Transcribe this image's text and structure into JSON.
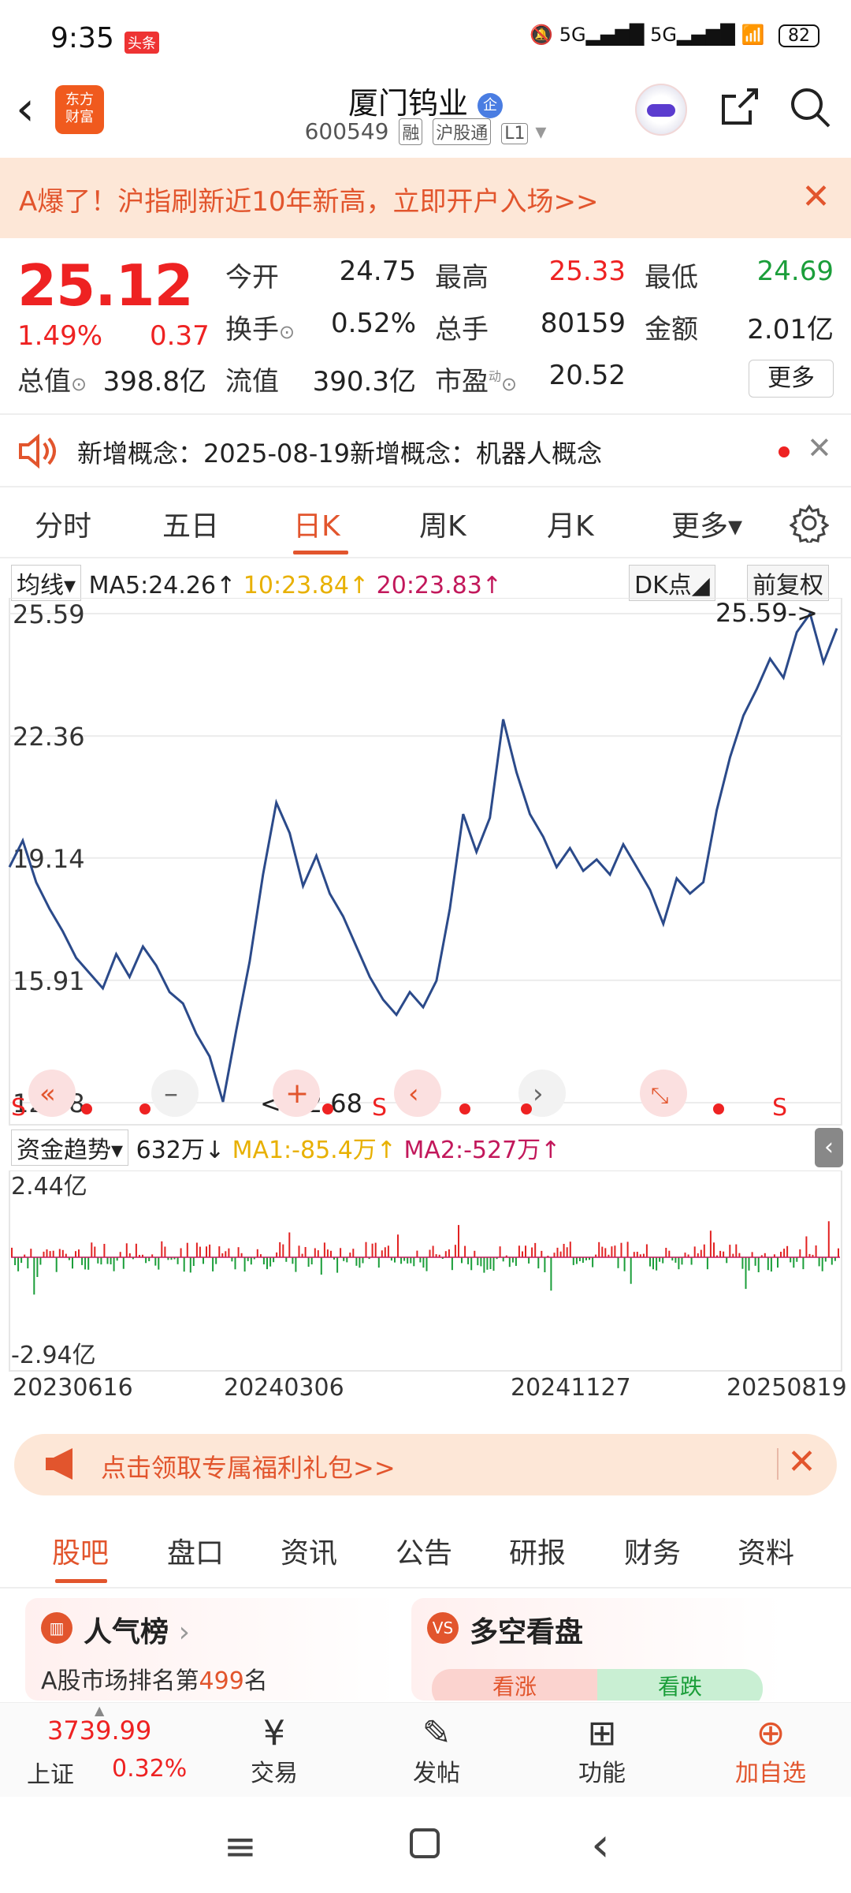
{
  "status": {
    "time": "9:35",
    "tag": "头条",
    "signal": "5G",
    "battery": "82"
  },
  "header": {
    "back": "‹",
    "logo": "东方\n财富",
    "name": "厦门钨业",
    "name_badge": "企",
    "code": "600549",
    "badges": [
      "融",
      "沪股通",
      "L1"
    ]
  },
  "banner": {
    "text": "A爆了！沪指刷新近10年新高，立即开户入场>>",
    "close": "✕"
  },
  "quote": {
    "price": "25.12",
    "pct": "1.49%",
    "change": "0.37",
    "rows": [
      [
        {
          "l": "今开",
          "v": "24.75",
          "c": ""
        },
        {
          "l": "最高",
          "v": "25.33",
          "c": "red"
        },
        {
          "l": "最低",
          "v": "24.69",
          "c": "green"
        }
      ],
      [
        {
          "l": "换手",
          "v": "0.52%",
          "c": ""
        },
        {
          "l": "总手",
          "v": "80159",
          "c": ""
        },
        {
          "l": "金额",
          "v": "2.01亿",
          "c": ""
        }
      ]
    ],
    "total_value_label": "总值",
    "total_value": "398.8亿",
    "float_label": "流值",
    "float_value": "390.3亿",
    "pe_label": "市盈",
    "pe_sup": "动",
    "pe_value": "20.52",
    "more": "更多"
  },
  "notice": {
    "text": "新增概念：2025-08-19新增概念：机器人概念",
    "close": "✕"
  },
  "tabs": [
    "分时",
    "五日",
    "日K",
    "周K",
    "月K",
    "更多▾"
  ],
  "active_tab": 2,
  "chart": {
    "ma_select": "均线▾",
    "ma5": "MA5:24.26↑",
    "ma10": "10:23.84↑",
    "ma20": "20:23.83↑",
    "dk": "DK点",
    "adjust": "前复权",
    "colors": {
      "ma5": "#222222",
      "ma10": "#e8b000",
      "ma20": "#c2185b",
      "price": "#2b4a8a",
      "up": "#e22222",
      "down": "#1b9e3a"
    }
  },
  "chart_data": {
    "type": "line",
    "title": "",
    "yticks": [
      "25.59",
      "22.36",
      "19.14",
      "15.91",
      "12.68"
    ],
    "ylim": [
      12.68,
      25.59
    ],
    "max_label": "25.59->",
    "min_label": "<-12.68",
    "x": [
      "20230616",
      "20240306",
      "20241127",
      "20250819"
    ],
    "series": [
      {
        "values": [
          18.9,
          19.6,
          18.5,
          17.8,
          17.2,
          16.5,
          16.1,
          15.7,
          16.6,
          16.0,
          16.8,
          16.3,
          15.6,
          15.3,
          14.5,
          13.9,
          12.7,
          14.6,
          16.4,
          18.7,
          20.6,
          19.8,
          18.4,
          19.2,
          18.2,
          17.6,
          16.8,
          16.0,
          15.4,
          15.0,
          15.6,
          15.2,
          15.9,
          17.8,
          20.3,
          19.3,
          20.2,
          22.8,
          21.4,
          20.3,
          19.7,
          18.9,
          19.4,
          18.8,
          19.1,
          18.7,
          19.5,
          18.9,
          18.3,
          17.4,
          18.6,
          18.2,
          18.5,
          20.4,
          21.8,
          22.9,
          23.6,
          24.4,
          23.9,
          25.1,
          25.59,
          24.3,
          25.2
        ]
      }
    ],
    "fund": {
      "label": "资金趋势▾",
      "value": "632万↓",
      "ma1": "MA1:-85.4万↑",
      "ma2": "MA2:-527万↑",
      "ymax": "2.44亿",
      "ymin": "-2.94亿"
    }
  },
  "gift": {
    "text": "点击领取专属福利礼包>>",
    "close": "✕"
  },
  "sub_tabs": [
    "股吧",
    "盘口",
    "资讯",
    "公告",
    "研报",
    "财务",
    "资料"
  ],
  "cards": [
    {
      "title": "人气榜",
      "arrow": "›",
      "sub_prefix": "A股市场排名第",
      "rank": "499",
      "sub_suffix": "名"
    },
    {
      "title": "多空看盘",
      "bull": "看涨",
      "bear": "看跌"
    }
  ],
  "bottom_nav": {
    "index_value": "3739.99",
    "index_name": "上证",
    "index_pct": "0.32%",
    "items": [
      "交易",
      "发帖",
      "功能",
      "加自选"
    ]
  }
}
